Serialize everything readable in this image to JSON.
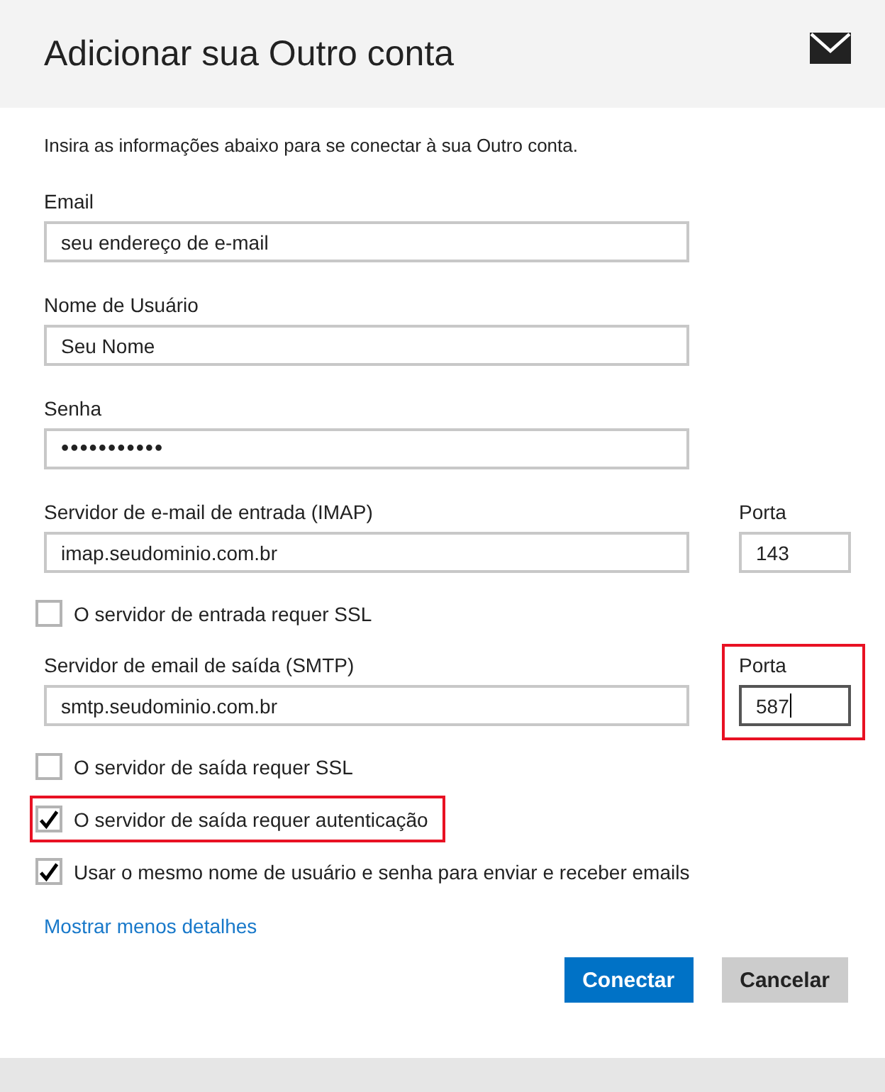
{
  "header": {
    "title": "Adicionar sua Outro conta"
  },
  "intro": "Insira as informações abaixo para se conectar à sua Outro conta.",
  "sections": [
    {
      "kind": "field",
      "label": "Email",
      "value": "seu endereço de e-mail"
    },
    {
      "kind": "field",
      "label": "Nome de Usuário",
      "value": "Seu Nome"
    },
    {
      "kind": "password",
      "label": "Senha",
      "value": "•••••••••••"
    },
    {
      "kind": "server",
      "label": "Servidor de e-mail de entrada (IMAP)",
      "value": "imap.seudominio.com.br",
      "port": {
        "label": "Porta",
        "value": "143",
        "focused": false,
        "highlighted": false
      }
    },
    {
      "kind": "checkbox",
      "label": "O servidor de entrada requer SSL",
      "checked": false,
      "highlighted": false
    },
    {
      "kind": "server",
      "label": "Servidor de email de saída (SMTP)",
      "value": "smtp.seudominio.com.br",
      "port": {
        "label": "Porta",
        "value": "587",
        "focused": true,
        "highlighted": true
      }
    },
    {
      "kind": "checkbox",
      "label": "O servidor de saída requer SSL",
      "checked": false,
      "highlighted": false
    },
    {
      "kind": "checkbox",
      "label": "O servidor de saída requer autenticação",
      "checked": true,
      "highlighted": true
    },
    {
      "kind": "checkbox",
      "label": "Usar o mesmo nome de usuário e senha para enviar e receber emails",
      "checked": true,
      "highlighted": false
    }
  ],
  "link": "Mostrar menos detalhes",
  "buttons": [
    {
      "label": "Conectar",
      "kind": "primary"
    },
    {
      "label": "Cancelar",
      "kind": "secondary"
    }
  ]
}
